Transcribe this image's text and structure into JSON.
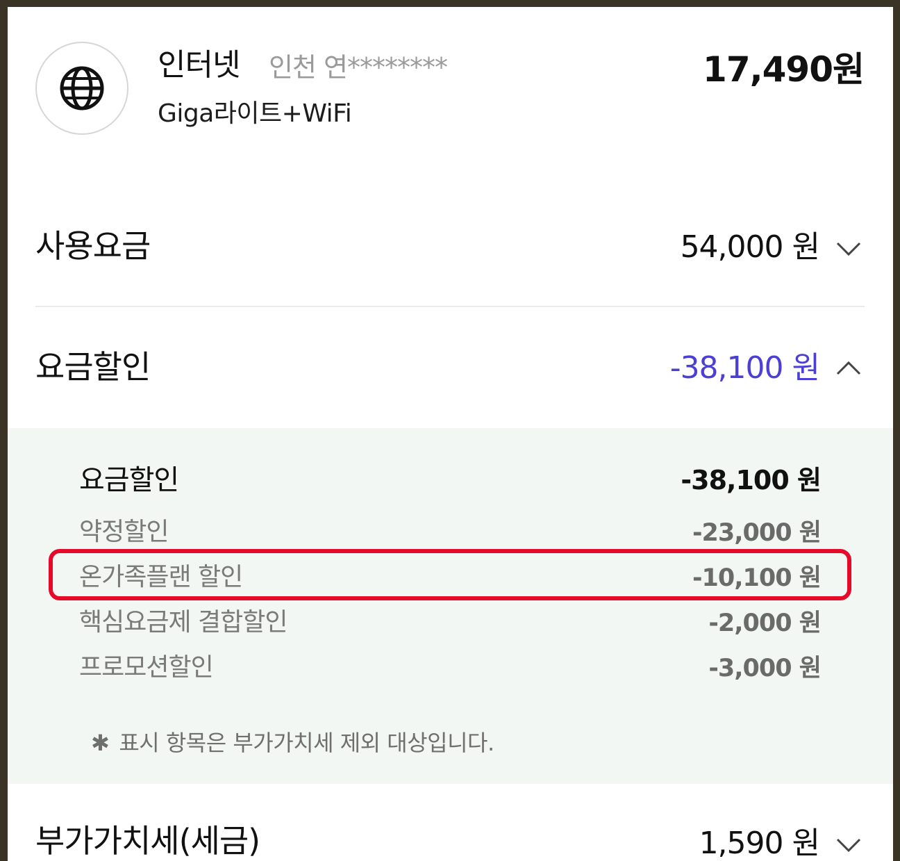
{
  "service": {
    "icon": "globe-icon",
    "name": "인터넷",
    "location": "인천 연********",
    "plan": "Giga라이트+WiFi",
    "total": "17,490원"
  },
  "usage_fee": {
    "label": "사용요금",
    "amount": "54,000 원",
    "expanded": false
  },
  "discount": {
    "label": "요금할인",
    "amount": "-38,100 원",
    "expanded": true,
    "accent_color": "#4b3fd6",
    "detail": {
      "title": "요금할인",
      "total": "-38,100 원",
      "items": [
        {
          "label": "약정할인",
          "amount": "-23,000 원"
        },
        {
          "label": "온가족플랜 할인",
          "amount": "-10,100 원"
        },
        {
          "label": "핵심요금제 결합할인",
          "amount": "-2,000 원"
        },
        {
          "label": "프로모션할인",
          "amount": "-3,000 원"
        }
      ],
      "note_marker": "✱",
      "note": "표시 항목은 부가가치세 제외 대상입니다."
    }
  },
  "vat": {
    "label": "부가가치세(세금)",
    "amount": "1,590 원",
    "expanded": false
  },
  "highlight_color": "#e50a2a"
}
